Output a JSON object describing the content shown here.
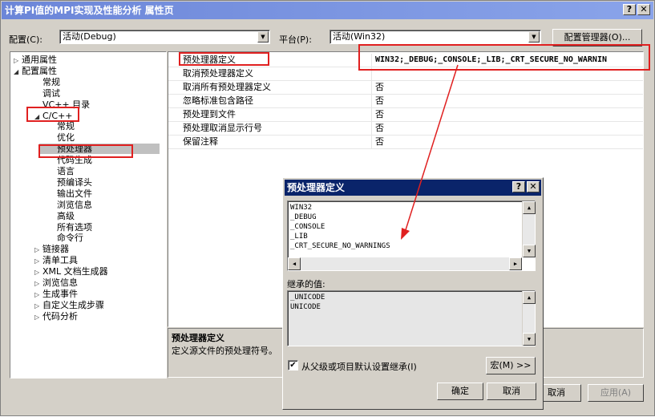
{
  "window": {
    "title": "计算PI值的MPI实现及性能分析 属性页",
    "help_btn": "?",
    "close_btn": "✕"
  },
  "top": {
    "config_label": "配置(C):",
    "config_value": "活动(Debug)",
    "platform_label": "平台(P):",
    "platform_value": "活动(Win32)",
    "config_manager": "配置管理器(O)..."
  },
  "tree": {
    "items": [
      {
        "label": "通用属性",
        "arrow": "▷"
      },
      {
        "label": "配置属性",
        "arrow": "◢"
      },
      {
        "label": "常规",
        "arrow": ""
      },
      {
        "label": "调试",
        "arrow": ""
      },
      {
        "label": "VC++ 目录",
        "arrow": ""
      },
      {
        "label": "C/C++",
        "arrow": "◢"
      },
      {
        "label": "常规",
        "arrow": ""
      },
      {
        "label": "优化",
        "arrow": ""
      },
      {
        "label": "预处理器",
        "arrow": ""
      },
      {
        "label": "代码生成",
        "arrow": ""
      },
      {
        "label": "语言",
        "arrow": ""
      },
      {
        "label": "预编译头",
        "arrow": ""
      },
      {
        "label": "输出文件",
        "arrow": ""
      },
      {
        "label": "浏览信息",
        "arrow": ""
      },
      {
        "label": "高级",
        "arrow": ""
      },
      {
        "label": "所有选项",
        "arrow": ""
      },
      {
        "label": "命令行",
        "arrow": ""
      },
      {
        "label": "链接器",
        "arrow": "▷"
      },
      {
        "label": "清单工具",
        "arrow": "▷"
      },
      {
        "label": "XML 文档生成器",
        "arrow": "▷"
      },
      {
        "label": "浏览信息",
        "arrow": "▷"
      },
      {
        "label": "生成事件",
        "arrow": "▷"
      },
      {
        "label": "自定义生成步骤",
        "arrow": "▷"
      },
      {
        "label": "代码分析",
        "arrow": "▷"
      }
    ]
  },
  "grid": {
    "rows": [
      {
        "key": "预处理器定义",
        "value": "WIN32;_DEBUG;_CONSOLE;_LIB;_CRT_SECURE_NO_WARNIN"
      },
      {
        "key": "取消预处理器定义",
        "value": ""
      },
      {
        "key": "取消所有预处理器定义",
        "value": "否"
      },
      {
        "key": "忽略标准包含路径",
        "value": "否"
      },
      {
        "key": "预处理到文件",
        "value": "否"
      },
      {
        "key": "预处理取消显示行号",
        "value": "否"
      },
      {
        "key": "保留注释",
        "value": "否"
      }
    ]
  },
  "description": {
    "title": "预处理器定义",
    "text": "定义源文件的预处理符号。"
  },
  "bottom": {
    "ok": "确定",
    "cancel": "取消",
    "apply": "应用(A)"
  },
  "dialog": {
    "title": "预处理器定义",
    "help": "?",
    "close": "✕",
    "defs": [
      "WIN32",
      "_DEBUG",
      "_CONSOLE",
      "_LIB",
      "_CRT_SECURE_NO_WARNINGS"
    ],
    "inherited_label": "继承的值:",
    "inherited": [
      "_UNICODE",
      "UNICODE"
    ],
    "inherit_check": "从父级或项目默认设置继承(I)",
    "macro_btn": "宏(M) >>",
    "ok": "确定",
    "cancel": "取消"
  },
  "colors": {
    "annotation": "#e02020",
    "dialog_title": "#0a246a"
  }
}
